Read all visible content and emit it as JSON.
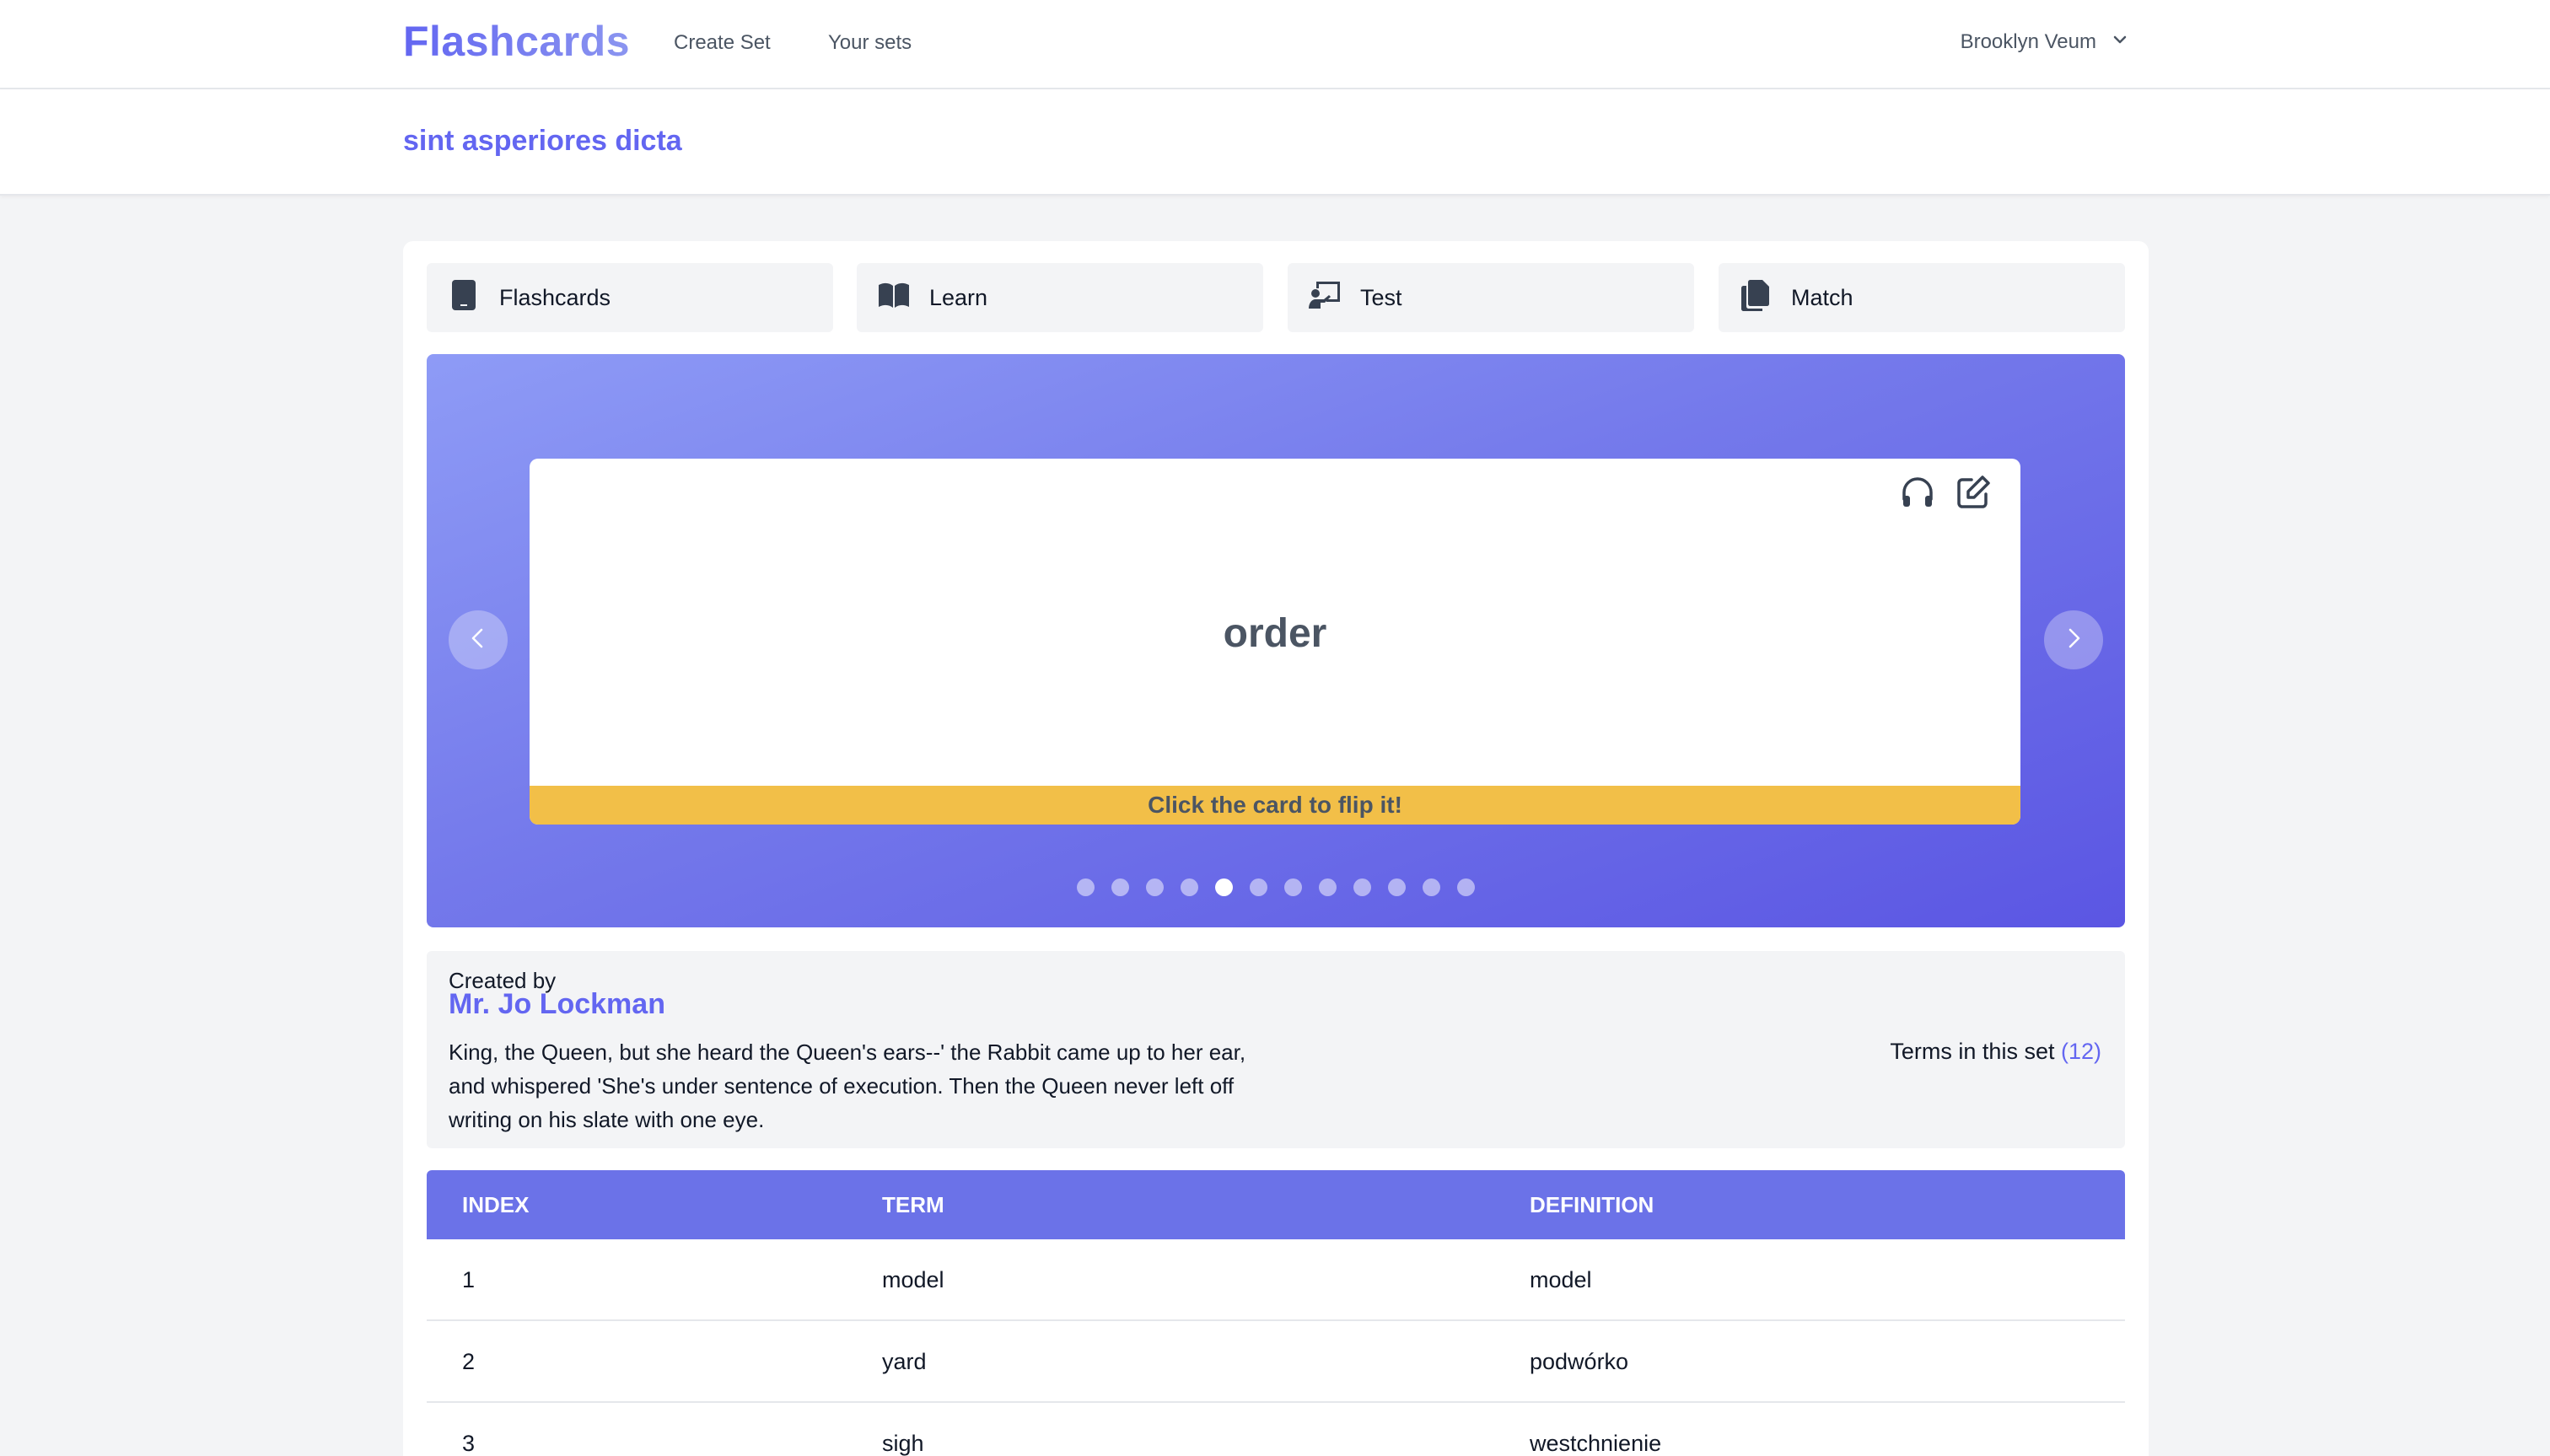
{
  "nav": {
    "brand": "Flashcards",
    "create_set": "Create Set",
    "your_sets": "Your sets",
    "user": "Brooklyn Veum"
  },
  "set": {
    "title": "sint asperiores dicta"
  },
  "modes": [
    {
      "label": "Flashcards",
      "icon": "tablet-icon"
    },
    {
      "label": "Learn",
      "icon": "book-open-icon"
    },
    {
      "label": "Test",
      "icon": "presentation-icon"
    },
    {
      "label": "Match",
      "icon": "copy-icon"
    }
  ],
  "carousel": {
    "term": "order",
    "hint": "Click the card to flip it!",
    "dot_count": 12,
    "active_dot": 5
  },
  "info": {
    "created_by_label": "Created by",
    "creator": "Mr. Jo Lockman",
    "description": "King, the Queen, but she heard the Queen's ears--' the Rabbit came up to her ear, and whispered 'She's under sentence of execution. Then the Queen never left off writing on his slate with one eye.",
    "terms_label": "Terms in this set",
    "terms_count": "(12)"
  },
  "table": {
    "headers": [
      "INDEX",
      "TERM",
      "DEFINITION"
    ],
    "rows": [
      [
        "1",
        "model",
        "model"
      ],
      [
        "2",
        "yard",
        "podwórko"
      ],
      [
        "3",
        "sigh",
        "westchnienie"
      ]
    ]
  },
  "colors": {
    "accent": "#6366f1",
    "hint_bar": "#f2bf48",
    "table_header": "#6b72e8"
  }
}
